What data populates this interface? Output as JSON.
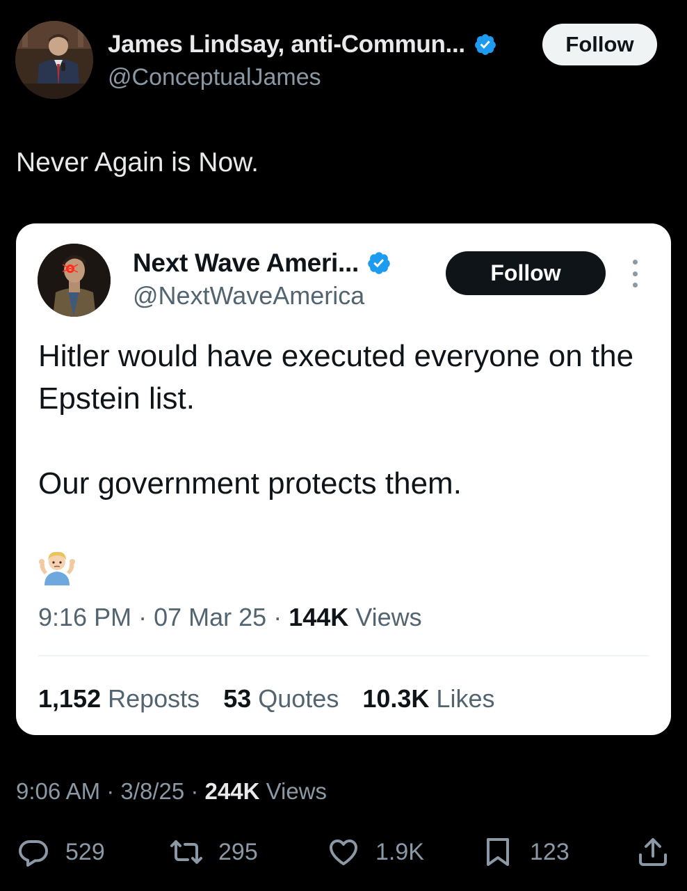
{
  "author": {
    "display_name": "James Lindsay, anti-Commun...",
    "handle": "@ConceptualJames",
    "follow_label": "Follow"
  },
  "tweet_text": "Never Again is Now.",
  "quoted": {
    "display_name": "Next Wave Ameri...",
    "handle": "@NextWaveAmerica",
    "follow_label": "Follow",
    "body_line_1": "Hitler would have executed everyone on the Epstein list.",
    "body_line_2": "Our government protects them.",
    "emoji": "🤷‍♂️",
    "time": "9:16 PM",
    "date": "07 Mar 25",
    "views_count": "144K",
    "views_label": "Views",
    "reposts_count": "1,152",
    "reposts_label": "Reposts",
    "quotes_count": "53",
    "quotes_label": "Quotes",
    "likes_count": "10.3K",
    "likes_label": "Likes"
  },
  "meta": {
    "time": "9:06 AM",
    "date": "3/8/25",
    "views_count": "244K",
    "views_label": "Views"
  },
  "actions": {
    "replies": "529",
    "reposts": "295",
    "likes": "1.9K",
    "bookmarks": "123"
  },
  "icons": {
    "verified": "verified-badge-icon",
    "reply": "reply-icon",
    "repost": "repost-icon",
    "like": "heart-icon",
    "bookmark": "bookmark-icon",
    "share": "share-icon",
    "more": "more-options-icon"
  },
  "colors": {
    "verified_blue": "#1d9bf0",
    "background": "#000000",
    "secondary_text": "#8b98a5"
  }
}
